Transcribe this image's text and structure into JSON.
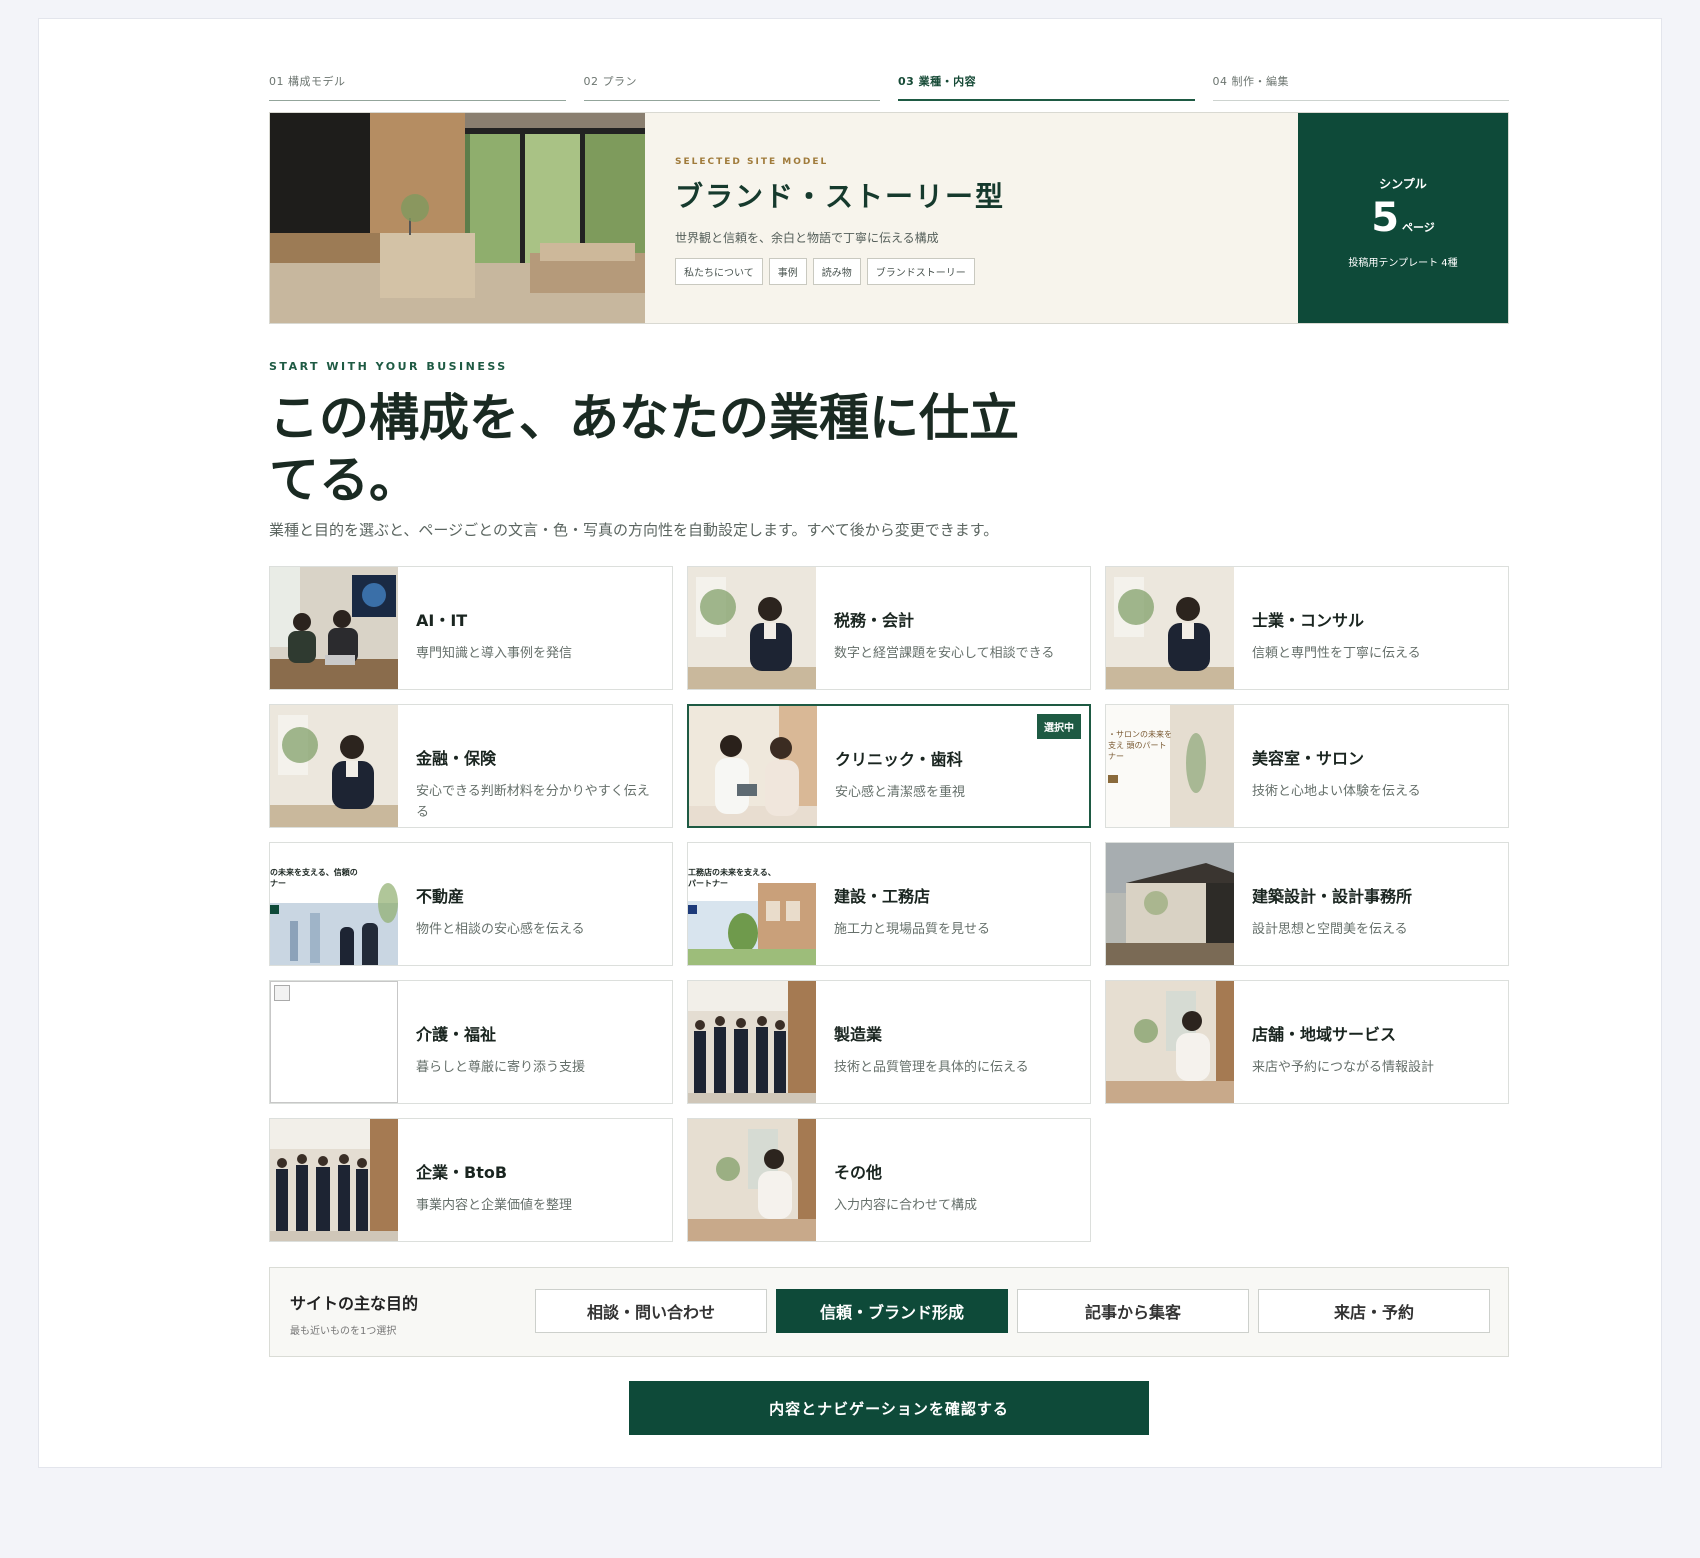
{
  "steps": [
    {
      "label": "01 構成モデル"
    },
    {
      "label": "02 プラン"
    },
    {
      "label": "03 業種・内容"
    },
    {
      "label": "04 制作・編集"
    }
  ],
  "model": {
    "eyebrow": "SELECTED SITE MODEL",
    "title": "ブランド・ストーリー型",
    "desc": "世界観と信頼を、余白と物語で丁寧に伝える構成",
    "chips": [
      "私たちについて",
      "事例",
      "読み物",
      "ブランドストーリー"
    ],
    "plan_label": "シンプル",
    "pages": "5",
    "pages_unit": "ページ",
    "templates": "投稿用テンプレート 4種"
  },
  "section": {
    "eyebrow": "START WITH YOUR BUSINESS",
    "heading": "この構成を、あなたの業種に仕立てる。",
    "desc": "業種と目的を選ぶと、ページごとの文言・色・写真の方向性を自動設定します。すべて後から変更できます。"
  },
  "industries": [
    {
      "title": "AI・IT",
      "desc": "専門知識と導入事例を発信"
    },
    {
      "title": "税務・会計",
      "desc": "数字と経営課題を安心して相談できる"
    },
    {
      "title": "士業・コンサル",
      "desc": "信頼と専門性を丁寧に伝える"
    },
    {
      "title": "金融・保険",
      "desc": "安心できる判断材料を分かりやすく伝える"
    },
    {
      "title": "クリニック・歯科",
      "desc": "安心感と清潔感を重視",
      "badge": "選択中"
    },
    {
      "title": "美容室・サロン",
      "desc": "技術と心地よい体験を伝える",
      "thumb_text": "・サロンの未来を支え 頭のパートナー"
    },
    {
      "title": "不動産",
      "desc": "物件と相談の安心感を伝える",
      "thumb_text": "の未来を支える、信頼の ナー"
    },
    {
      "title": "建設・工務店",
      "desc": "施工力と現場品質を見せる",
      "thumb_text": "工務店の未来を支える、 パートナー"
    },
    {
      "title": "建築設計・設計事務所",
      "desc": "設計思想と空間美を伝える"
    },
    {
      "title": "介護・福祉",
      "desc": "暮らしと尊厳に寄り添う支援"
    },
    {
      "title": "製造業",
      "desc": "技術と品質管理を具体的に伝える"
    },
    {
      "title": "店舗・地域サービス",
      "desc": "来店や予約につながる情報設計"
    },
    {
      "title": "企業・BtoB",
      "desc": "事業内容と企業価値を整理"
    },
    {
      "title": "その他",
      "desc": "入力内容に合わせて構成"
    }
  ],
  "purpose": {
    "title": "サイトの主な目的",
    "sub": "最も近いものを1つ選択",
    "options": [
      "相談・問い合わせ",
      "信頼・ブランド形成",
      "記事から集客",
      "来店・予約"
    ],
    "selected": "信頼・ブランド形成"
  },
  "cta": "内容とナビゲーションを確認する",
  "colors": {
    "brand": "#0e4a39",
    "accent_gold": "#a07b3b",
    "background": "#f3f4f9"
  }
}
